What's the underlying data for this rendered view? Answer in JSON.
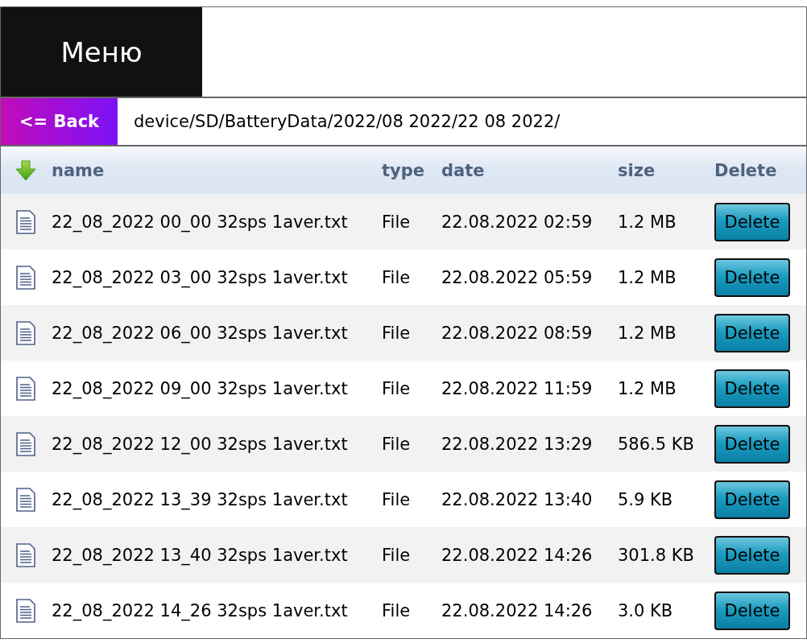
{
  "menu": {
    "label": "Меню"
  },
  "path_bar": {
    "back_button": "<= Back",
    "path": "device/SD/BatteryData/2022/08 2022/22 08 2022/"
  },
  "table": {
    "columns": [
      "name",
      "type",
      "date",
      "size",
      "Delete"
    ],
    "rows": [
      {
        "name": "22_08_2022 00_00 32sps 1aver.txt",
        "type": "File",
        "date": "22.08.2022 02:59",
        "size": "1.2 MB",
        "action": "Delete"
      },
      {
        "name": "22_08_2022 03_00 32sps 1aver.txt",
        "type": "File",
        "date": "22.08.2022 05:59",
        "size": "1.2 MB",
        "action": "Delete"
      },
      {
        "name": "22_08_2022 06_00 32sps 1aver.txt",
        "type": "File",
        "date": "22.08.2022 08:59",
        "size": "1.2 MB",
        "action": "Delete"
      },
      {
        "name": "22_08_2022 09_00 32sps 1aver.txt",
        "type": "File",
        "date": "22.08.2022 11:59",
        "size": "1.2 MB",
        "action": "Delete"
      },
      {
        "name": "22_08_2022 12_00 32sps 1aver.txt",
        "type": "File",
        "date": "22.08.2022 13:29",
        "size": "586.5 KB",
        "action": "Delete"
      },
      {
        "name": "22_08_2022 13_39 32sps 1aver.txt",
        "type": "File",
        "date": "22.08.2022 13:40",
        "size": "5.9 KB",
        "action": "Delete"
      },
      {
        "name": "22_08_2022 13_40 32sps 1aver.txt",
        "type": "File",
        "date": "22.08.2022 14:26",
        "size": "301.8 KB",
        "action": "Delete"
      },
      {
        "name": "22_08_2022 14_26 32sps 1aver.txt",
        "type": "File",
        "date": "22.08.2022 14:26",
        "size": "3.0 KB",
        "action": "Delete"
      }
    ]
  }
}
